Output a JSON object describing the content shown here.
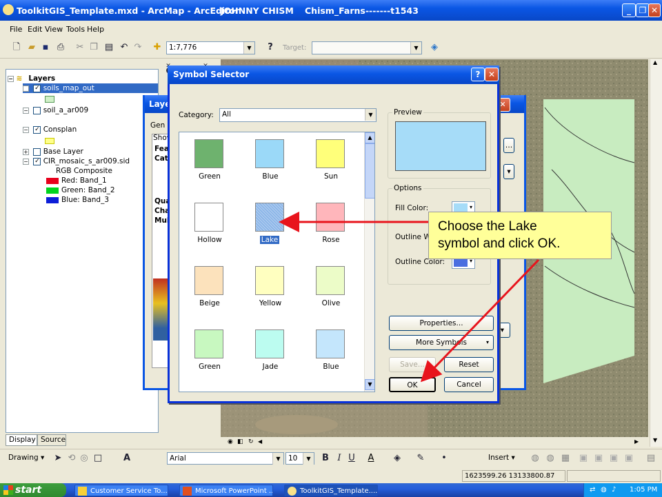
{
  "window": {
    "title": "ToolkitGIS_Template.mxd - ArcMap - ArcEditor",
    "user": "JOHNNY CHISM",
    "document": "Chism_Farns-------t1543"
  },
  "menu": [
    "File",
    "Edit",
    "View",
    "Tools",
    "Help"
  ],
  "toolbar": {
    "scale": "1:7,776",
    "target_label": "Target:",
    "target_value": ""
  },
  "toc": {
    "root": "Layers",
    "layers": [
      {
        "name": "soils_map_out",
        "checked": true,
        "selected": true
      },
      {
        "name": "soil_a_ar009",
        "checked": false
      },
      {
        "name": "Consplan",
        "checked": true
      },
      {
        "name": "Base Layer",
        "checked": false
      },
      {
        "name": "CIR_mosaic_s_ar009.sid",
        "checked": true
      }
    ],
    "rgb_title": "RGB Composite",
    "bands": [
      {
        "label": "Red:",
        "band": "Band_1",
        "color": "#e8001c"
      },
      {
        "label": "Green:",
        "band": "Band_2",
        "color": "#00d41e"
      },
      {
        "label": "Blue:",
        "band": "Band_3",
        "color": "#0c1ed8"
      }
    ],
    "tabs": [
      "Display",
      "Source"
    ]
  },
  "layer_dialog": {
    "title": "Layer",
    "items": [
      "Gen",
      "Show",
      "Fea",
      "Cate",
      "Qua",
      "Cha",
      "Mul"
    ]
  },
  "symbol_selector": {
    "title": "Symbol Selector",
    "category_label": "Category:",
    "category_value": "All",
    "symbols": [
      {
        "name": "Green",
        "color": "#6eb26e"
      },
      {
        "name": "Blue",
        "color": "#9bd9f8"
      },
      {
        "name": "Sun",
        "color": "#ffff7a"
      },
      {
        "name": "Hollow",
        "color": "#ffffff"
      },
      {
        "name": "Lake",
        "color": "#8cb6e8",
        "selected": true
      },
      {
        "name": "Rose",
        "color": "#ffb6bb"
      },
      {
        "name": "Beige",
        "color": "#fce2bc"
      },
      {
        "name": "Yellow",
        "color": "#ffffc0"
      },
      {
        "name": "Olive",
        "color": "#ecfcc8"
      },
      {
        "name": "Green",
        "color": "#c8f8c0"
      },
      {
        "name": "Jade",
        "color": "#bcfcf0"
      },
      {
        "name": "Blue",
        "color": "#c4e6fc"
      },
      {
        "name": "",
        "color": "#bcd0fc"
      },
      {
        "name": "",
        "color": "#e8c4fc"
      },
      {
        "name": "",
        "color": "#fcbcec"
      }
    ],
    "preview_label": "Preview",
    "preview_color": "#a6dcf8",
    "options_label": "Options",
    "fill_color_label": "Fill Color:",
    "fill_color": "#a6dcf8",
    "outline_width_label": "Outline W",
    "outline_color_label": "Outline Color:",
    "outline_color": "#4a6ee0",
    "buttons": {
      "properties": "Properties...",
      "more_symbols": "More Symbols",
      "save": "Save...",
      "reset": "Reset",
      "ok": "OK",
      "cancel": "Cancel"
    }
  },
  "callout": {
    "line1": "Choose the Lake",
    "line2": "symbol and click OK."
  },
  "drawing_toolbar": {
    "drawing": "Drawing",
    "font": "Arial",
    "size": "10",
    "insert": "Insert"
  },
  "status": {
    "coords": "1623599.26  13133800.87 Feet"
  },
  "taskbar": {
    "start": "start",
    "tasks": [
      "Customer Service To...",
      "Microsoft PowerPoint ...",
      "ToolkitGIS_Template...."
    ],
    "clock": "1:05 PM"
  }
}
